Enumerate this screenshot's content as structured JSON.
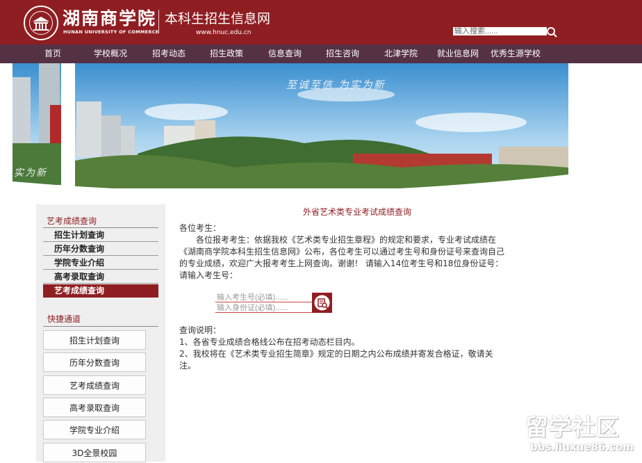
{
  "header": {
    "logo_cn": "湖南商学院",
    "logo_en": "HUNAN UNIVERSITY OF COMMERCE",
    "site_title": "本科生招生信息网",
    "site_url": "www.hnuc.edu.cn",
    "search_placeholder": "输入搜索......"
  },
  "nav": [
    "首页",
    "学校概况",
    "招考动态",
    "招生政策",
    "信息查询",
    "招生咨询",
    "北津学院",
    "就业信息网",
    "优秀生源学校"
  ],
  "banner": {
    "slogan": "至诚至信 为实为新",
    "slogan_left": "实为新"
  },
  "sidebar": {
    "title": "艺考成绩查询",
    "items": [
      "招生计划查询",
      "历年分数查询",
      "学院专业介绍",
      "高考录取查询",
      "艺考成绩查询"
    ],
    "active_index": 4,
    "quick_title": "快捷通道",
    "quick_links": [
      "招生计划查询",
      "历年分数查询",
      "艺考成绩查询",
      "高考录取查询",
      "学院专业介绍",
      "3D全景校园"
    ]
  },
  "main": {
    "title": "外省艺术类专业考试成绩查询",
    "greeting": "各位考生：",
    "para_line1": "各位报考考生：依据我校《艺术类专业招生章程》的规定和要求，专业考试成绩在",
    "para_line2": "《湖南商学院本科生招生信息网》公布，各位考生可以通过考生号和身份证号来查询自己",
    "para_line3": "的专业成绩，欢迎广大报考考生上网查询。谢谢！ 请输入14位考生号和18位身份证号：",
    "prompt": "请输入考生号：",
    "exam_no_placeholder": "输入考生号(必填)......",
    "id_no_placeholder": "输入身份证(必填)......",
    "notes_title": "查询说明：",
    "note1": "1、各省专业成绩合格线公布在招考动态栏目内。",
    "note2_line1": "2、我校将在《艺术类专业招生简章》规定的日期之内公布成绩并寄发合格证，敬请关",
    "note2_line2": "注。"
  },
  "watermark": {
    "text": "留学社区",
    "url": "bbs.liuxue86.com"
  },
  "colors": {
    "brand": "#8f1e22",
    "nav_bg": "#553144",
    "sidebar_bg": "#efefef"
  }
}
